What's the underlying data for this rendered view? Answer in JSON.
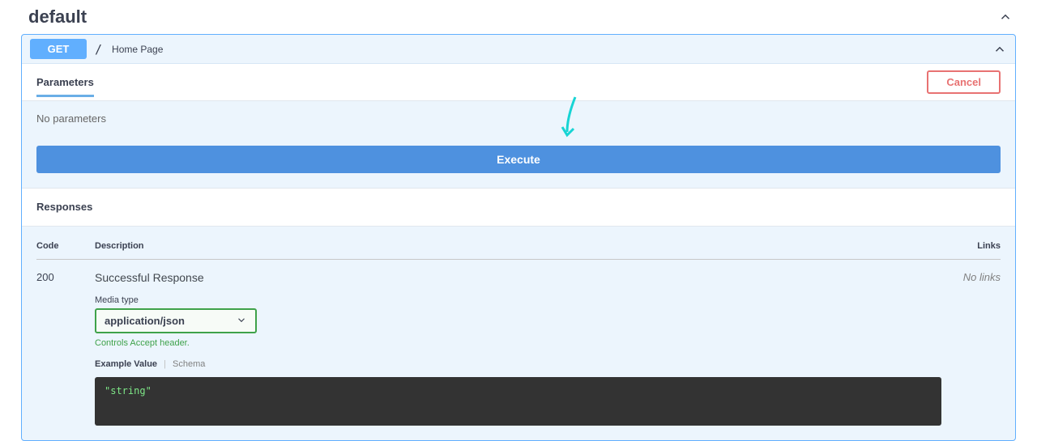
{
  "section": {
    "title": "default"
  },
  "operation": {
    "method": "GET",
    "path": "/",
    "summary": "Home Page"
  },
  "parameters": {
    "heading": "Parameters",
    "cancel_label": "Cancel",
    "empty_text": "No parameters",
    "execute_label": "Execute"
  },
  "responses": {
    "heading": "Responses",
    "columns": {
      "code": "Code",
      "description": "Description",
      "links": "Links"
    },
    "rows": [
      {
        "code": "200",
        "description": "Successful Response",
        "links": "No links",
        "media_label": "Media type",
        "media_value": "application/json",
        "media_hint": "Controls Accept header.",
        "tabs": {
          "example": "Example Value",
          "schema": "Schema"
        },
        "example": "\"string\""
      }
    ]
  }
}
